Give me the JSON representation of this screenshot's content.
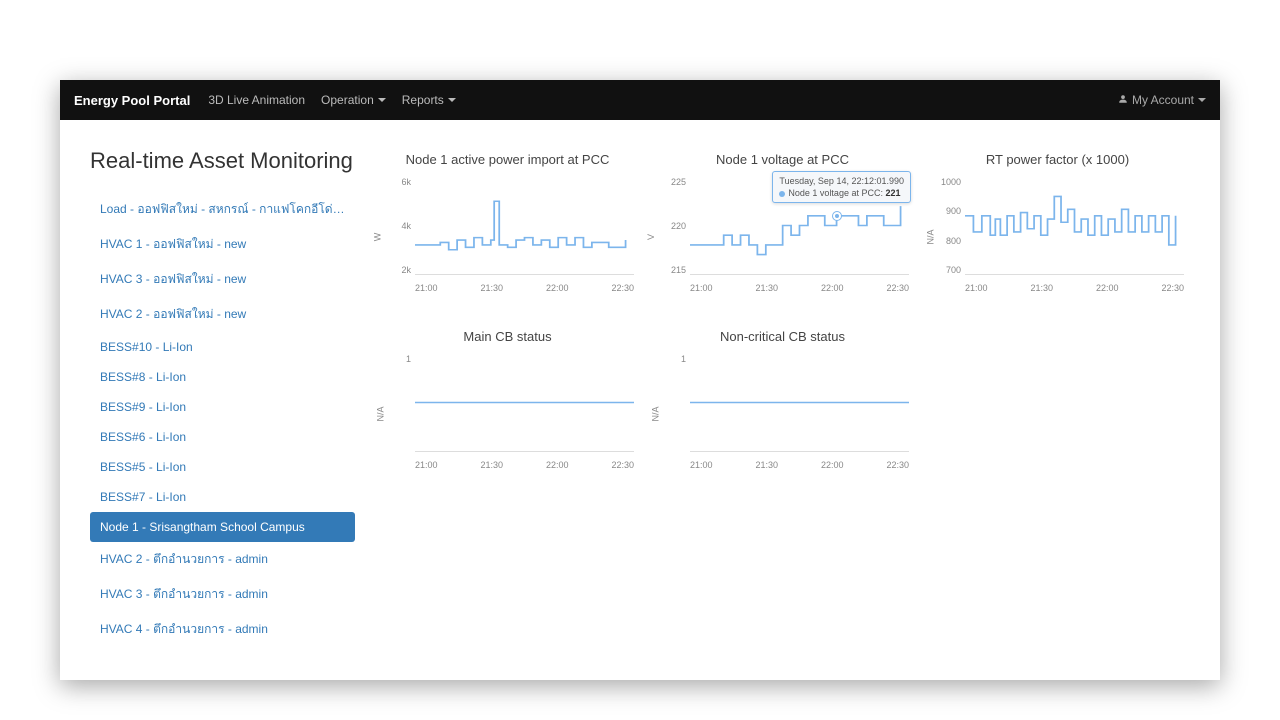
{
  "navbar": {
    "brand": "Energy Pool Portal",
    "links": [
      {
        "label": "3D Live Animation",
        "dropdown": false
      },
      {
        "label": "Operation",
        "dropdown": true
      },
      {
        "label": "Reports",
        "dropdown": true
      }
    ],
    "account_label": "My Account"
  },
  "page_title": "Real-time Asset Monitoring",
  "assets": [
    {
      "label": "Load - ออฟฟิสใหม่ - สหกรณ์ - กาแฟโคกอีโด่ย - new",
      "active": false
    },
    {
      "label": "HVAC 1 - ออฟฟิสใหม่ - new",
      "active": false
    },
    {
      "label": "HVAC 3 - ออฟฟิสใหม่ - new",
      "active": false
    },
    {
      "label": "HVAC 2 - ออฟฟิสใหม่ - new",
      "active": false
    },
    {
      "label": "BESS#10 - Li-Ion",
      "active": false
    },
    {
      "label": "BESS#8 - Li-Ion",
      "active": false
    },
    {
      "label": "BESS#9 - Li-Ion",
      "active": false
    },
    {
      "label": "BESS#6 - Li-Ion",
      "active": false
    },
    {
      "label": "BESS#5 - Li-Ion",
      "active": false
    },
    {
      "label": "BESS#7 - Li-Ion",
      "active": false
    },
    {
      "label": "Node 1 - Srisangtham School Campus",
      "active": true
    },
    {
      "label": "HVAC 2 - ตึกอำนวยการ - admin",
      "active": false
    },
    {
      "label": "HVAC 3 - ตึกอำนวยการ - admin",
      "active": false
    },
    {
      "label": "HVAC 4 - ตึกอำนวยการ - admin",
      "active": false
    }
  ],
  "chart_data": [
    {
      "id": "active_power",
      "type": "line",
      "title": "Node 1 active power import at PCC",
      "ylabel": "W",
      "ylim": [
        2000,
        6000
      ],
      "y_ticks": [
        "6k",
        "4k",
        "2k"
      ],
      "x_ticks": [
        "21:00",
        "21:30",
        "22:00",
        "22:30"
      ],
      "x": [
        "20:45",
        "21:00",
        "21:05",
        "21:10",
        "21:15",
        "21:20",
        "21:25",
        "21:30",
        "21:32",
        "21:35",
        "21:40",
        "21:45",
        "21:50",
        "21:55",
        "22:00",
        "22:05",
        "22:10",
        "22:15",
        "22:20",
        "22:25",
        "22:30",
        "22:40",
        "22:50"
      ],
      "values": [
        3200,
        3300,
        3000,
        3400,
        3100,
        3500,
        3200,
        3400,
        5000,
        3200,
        3100,
        3400,
        3500,
        3200,
        3400,
        3100,
        3500,
        3200,
        3500,
        3100,
        3300,
        3100,
        3400
      ]
    },
    {
      "id": "voltage",
      "type": "line",
      "title": "Node 1 voltage at PCC",
      "ylabel": "V",
      "ylim": [
        215,
        225
      ],
      "y_ticks": [
        "225",
        "220",
        "215"
      ],
      "x_ticks": [
        "21:00",
        "21:30",
        "22:00",
        "22:30"
      ],
      "x": [
        "20:45",
        "20:55",
        "21:05",
        "21:10",
        "21:15",
        "21:20",
        "21:25",
        "21:30",
        "21:35",
        "21:40",
        "21:45",
        "21:50",
        "21:55",
        "22:00",
        "22:05",
        "22:12",
        "22:20",
        "22:25",
        "22:30",
        "22:40",
        "22:50"
      ],
      "values": [
        218,
        218,
        219,
        218,
        219,
        218,
        217,
        218,
        218,
        220,
        219,
        220,
        221,
        221,
        220,
        221,
        221,
        220,
        221,
        220,
        222
      ],
      "tooltip": {
        "timestamp": "Tuesday, Sep 14, 22:12:01.990",
        "series": "Node 1 voltage at PCC",
        "value": "221"
      }
    },
    {
      "id": "power_factor",
      "type": "line",
      "title": "RT power factor (x 1000)",
      "ylabel": "N/A",
      "ylim": [
        700,
        1000
      ],
      "y_ticks": [
        "1000",
        "900",
        "800",
        "700"
      ],
      "x_ticks": [
        "21:00",
        "21:30",
        "22:00",
        "22:30"
      ],
      "x": [
        "20:45",
        "20:50",
        "20:55",
        "21:00",
        "21:03",
        "21:06",
        "21:10",
        "21:14",
        "21:18",
        "21:22",
        "21:26",
        "21:30",
        "21:34",
        "21:38",
        "21:42",
        "21:46",
        "21:50",
        "21:54",
        "21:58",
        "22:02",
        "22:06",
        "22:10",
        "22:14",
        "22:18",
        "22:22",
        "22:26",
        "22:30",
        "22:34",
        "22:38",
        "22:42",
        "22:46",
        "22:50"
      ],
      "values": [
        880,
        830,
        880,
        820,
        870,
        820,
        880,
        830,
        890,
        840,
        880,
        820,
        870,
        940,
        860,
        900,
        830,
        870,
        820,
        880,
        820,
        870,
        830,
        900,
        830,
        880,
        830,
        880,
        830,
        880,
        790,
        880
      ]
    },
    {
      "id": "main_cb",
      "type": "line",
      "title": "Main CB status",
      "ylabel": "N/A",
      "ylim": [
        0,
        2
      ],
      "y_ticks": [
        "1"
      ],
      "x_ticks": [
        "21:00",
        "21:30",
        "22:00",
        "22:30"
      ],
      "x": [
        "20:45",
        "22:55"
      ],
      "values": [
        1,
        1
      ]
    },
    {
      "id": "noncritical_cb",
      "type": "line",
      "title": "Non-critical CB status",
      "ylabel": "N/A",
      "ylim": [
        0,
        2
      ],
      "y_ticks": [
        "1"
      ],
      "x_ticks": [
        "21:00",
        "21:30",
        "22:00",
        "22:30"
      ],
      "x": [
        "20:45",
        "22:55"
      ],
      "values": [
        1,
        1
      ]
    }
  ]
}
